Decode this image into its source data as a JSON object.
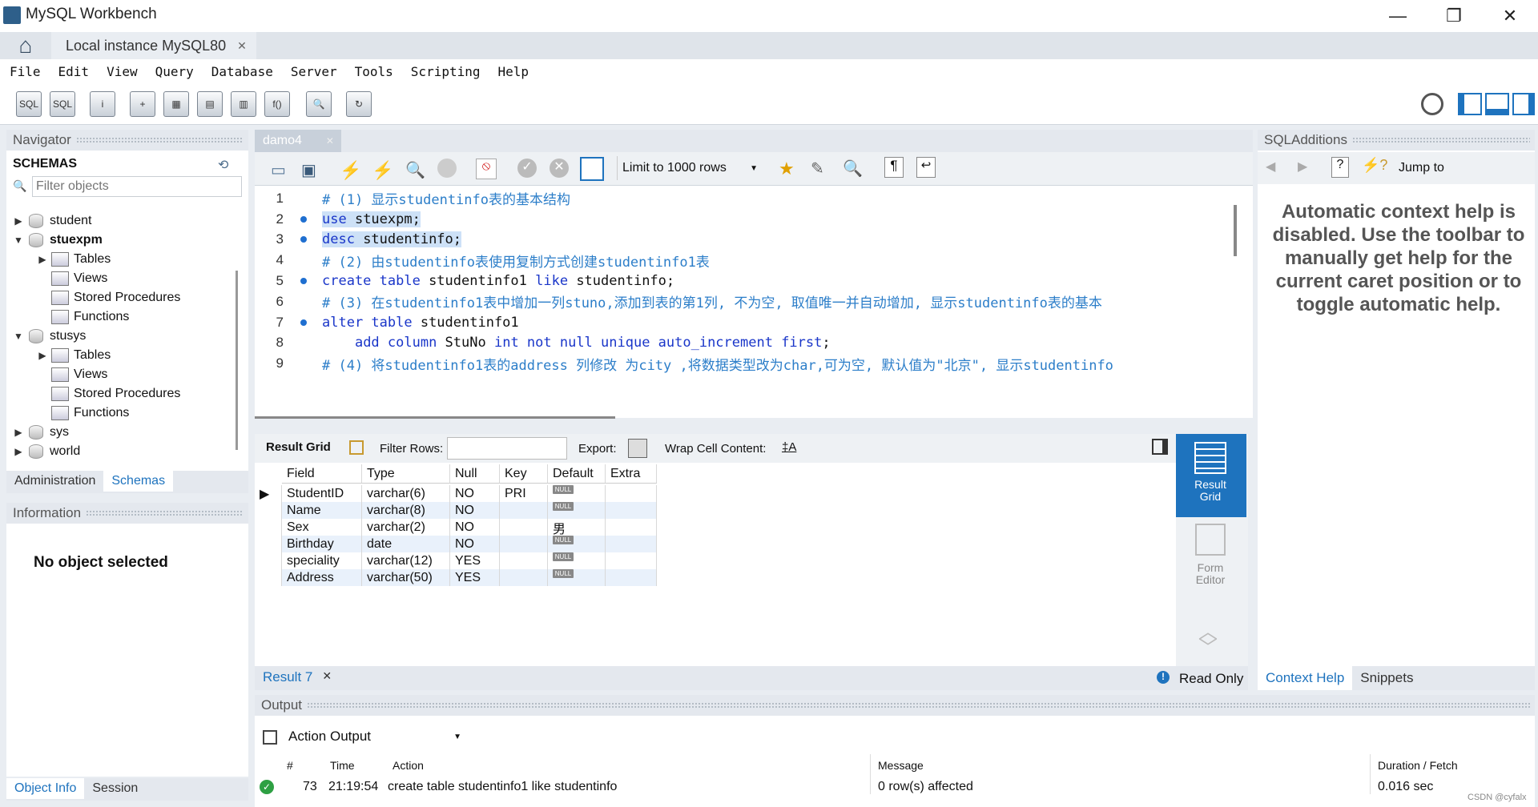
{
  "window": {
    "title": "MySQL Workbench",
    "minimize": "—",
    "restore": "❐",
    "close": "✕"
  },
  "tabs": {
    "home": "⌂",
    "connection": "Local instance MySQL80",
    "close": "✕"
  },
  "menu": [
    "File",
    "Edit",
    "View",
    "Query",
    "Database",
    "Server",
    "Tools",
    "Scripting",
    "Help"
  ],
  "toolbar_icons": [
    "new-sql-tab-icon",
    "open-sql-script-icon",
    "inspector-icon",
    "create-schema-icon",
    "create-table-icon",
    "create-view-icon",
    "create-procedure-icon",
    "create-function-icon",
    "search-table-data-icon",
    "reconnect-icon"
  ],
  "navigator": {
    "header": "Navigator",
    "schemas_label": "SCHEMAS",
    "filter_placeholder": "Filter objects",
    "tree": [
      {
        "label": "student",
        "level": 0,
        "expanded": false,
        "bold": false,
        "kind": "db"
      },
      {
        "label": "stuexpm",
        "level": 0,
        "expanded": true,
        "bold": true,
        "kind": "db"
      },
      {
        "label": "Tables",
        "level": 1,
        "expanded": false,
        "kind": "folder"
      },
      {
        "label": "Views",
        "level": 1,
        "kind": "folder"
      },
      {
        "label": "Stored Procedures",
        "level": 1,
        "kind": "folder"
      },
      {
        "label": "Functions",
        "level": 1,
        "kind": "folder"
      },
      {
        "label": "stusys",
        "level": 0,
        "expanded": true,
        "bold": false,
        "kind": "db"
      },
      {
        "label": "Tables",
        "level": 1,
        "expanded": false,
        "kind": "folder"
      },
      {
        "label": "Views",
        "level": 1,
        "kind": "folder"
      },
      {
        "label": "Stored Procedures",
        "level": 1,
        "kind": "folder"
      },
      {
        "label": "Functions",
        "level": 1,
        "kind": "folder"
      },
      {
        "label": "sys",
        "level": 0,
        "expanded": false,
        "bold": false,
        "kind": "db"
      },
      {
        "label": "world",
        "level": 0,
        "expanded": false,
        "bold": false,
        "kind": "db"
      }
    ],
    "tab_admin": "Administration",
    "tab_schemas": "Schemas",
    "info_header": "Information",
    "no_object": "No object selected",
    "tab_object_info": "Object Info",
    "tab_session": "Session"
  },
  "editor": {
    "tab": "damo4",
    "limit": "Limit to 1000 rows",
    "lines": [
      {
        "n": "1",
        "dot": false,
        "html": "<span class='cm'># (1) 显示studentinfo表的基本结构</span>"
      },
      {
        "n": "2",
        "dot": true,
        "html": "<span class='sel'><span class='kw'>use</span> stuexpm; </span>"
      },
      {
        "n": "3",
        "dot": true,
        "html": "<span class='sel'><span class='kw'>desc</span> studentinfo;</span>"
      },
      {
        "n": "4",
        "dot": false,
        "html": "<span class='cm'># (2) 由studentinfo表使用复制方式创建studentinfo1表</span>"
      },
      {
        "n": "5",
        "dot": true,
        "html": "<span class='kw'>create table</span> studentinfo1 <span class='kw'>like</span> studentinfo;"
      },
      {
        "n": "6",
        "dot": false,
        "html": "<span class='cm'># (3) 在studentinfo1表中增加一列stuno,添加到表的第1列, 不为空, 取值唯一并自动增加, 显示studentinfo表的基本</span>"
      },
      {
        "n": "7",
        "dot": true,
        "html": "<span class='kw'>alter table</span> studentinfo1"
      },
      {
        "n": "8",
        "dot": false,
        "html": "&nbsp;&nbsp;&nbsp;&nbsp;<span class='kw'>add column</span> StuNo <span class='kw'>int not null unique auto_increment first</span>;"
      },
      {
        "n": "9",
        "dot": false,
        "html": "<span class='cm'># (4) 将studentinfo1表的address 列修改 为city ,将数据类型改为char,可为空, 默认值为\"北京\", 显示studentinfo</span>"
      }
    ]
  },
  "result": {
    "grid_label": "Result Grid",
    "filter_label": "Filter Rows:",
    "export_label": "Export:",
    "wrap_label": "Wrap Cell Content:",
    "columns": [
      "Field",
      "Type",
      "Null",
      "Key",
      "Default",
      "Extra"
    ],
    "rows": [
      [
        "StudentID",
        "varchar(6)",
        "NO",
        "PRI",
        "NULL",
        ""
      ],
      [
        "Name",
        "varchar(8)",
        "NO",
        "",
        "NULL",
        ""
      ],
      [
        "Sex",
        "varchar(2)",
        "NO",
        "",
        "男",
        ""
      ],
      [
        "Birthday",
        "date",
        "NO",
        "",
        "NULL",
        ""
      ],
      [
        "speciality",
        "varchar(12)",
        "YES",
        "",
        "NULL",
        ""
      ],
      [
        "Address",
        "varchar(50)",
        "YES",
        "",
        "NULL",
        ""
      ]
    ],
    "side_result": "Result Grid",
    "side_form": "Form Editor",
    "tab": "Result 7",
    "readonly": "Read Only"
  },
  "sql_additions": {
    "header": "SQLAdditions",
    "jump_to": "Jump to",
    "help_text": "Automatic context help is disabled. Use the toolbar to manually get help for the current caret position or to toggle automatic help.",
    "tab_context": "Context Help",
    "tab_snippets": "Snippets"
  },
  "output": {
    "header": "Output",
    "selector": "Action Output",
    "columns": [
      "#",
      "Time",
      "Action",
      "Message",
      "Duration / Fetch"
    ],
    "rows": [
      {
        "num": "73",
        "time": "21:19:54",
        "action": "create table studentinfo1 like studentinfo",
        "message": "0 row(s) affected",
        "duration": "0.016 sec"
      }
    ]
  },
  "watermark": "CSDN @cyfalx",
  "colors": {
    "accent": "#1e73be",
    "selection": "#cde1f7",
    "keyword": "#1a36c9",
    "comment": "#2c7ec9"
  }
}
